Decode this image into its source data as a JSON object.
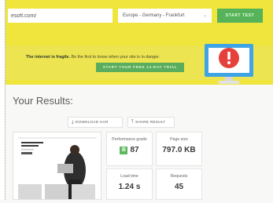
{
  "search": {
    "url_value": "esoft.com/"
  },
  "location": {
    "selected": "Europe - Germany - Frankfurt"
  },
  "buttons": {
    "start_test": "START TEST",
    "start_trial": "START YOUR FREE 14-DAY TRIAL"
  },
  "banner": {
    "bold": "The internet is fragile.",
    "rest": " Be the first to know when your site is in danger."
  },
  "results": {
    "title": "Your Results:",
    "download_har": "DOWNLOAD HAR",
    "share_result": "SHARE RESULT",
    "metrics": [
      {
        "label": "Performance grade",
        "grade": "B",
        "value": "87"
      },
      {
        "label": "Page size",
        "value": "797.0 KB"
      },
      {
        "label": "Load time",
        "value": "1.24 s"
      },
      {
        "label": "Requests",
        "value": "45"
      }
    ]
  },
  "icons": {
    "alert": "alert-monitor-icon",
    "download": "download-icon",
    "share": "share-icon",
    "dropdown": "chevron-down-icon"
  },
  "colors": {
    "hero_yellow": "#f0e53c",
    "green": "#56b35a",
    "alert_red": "#e5403b",
    "monitor_blue": "#3fa4e6"
  }
}
